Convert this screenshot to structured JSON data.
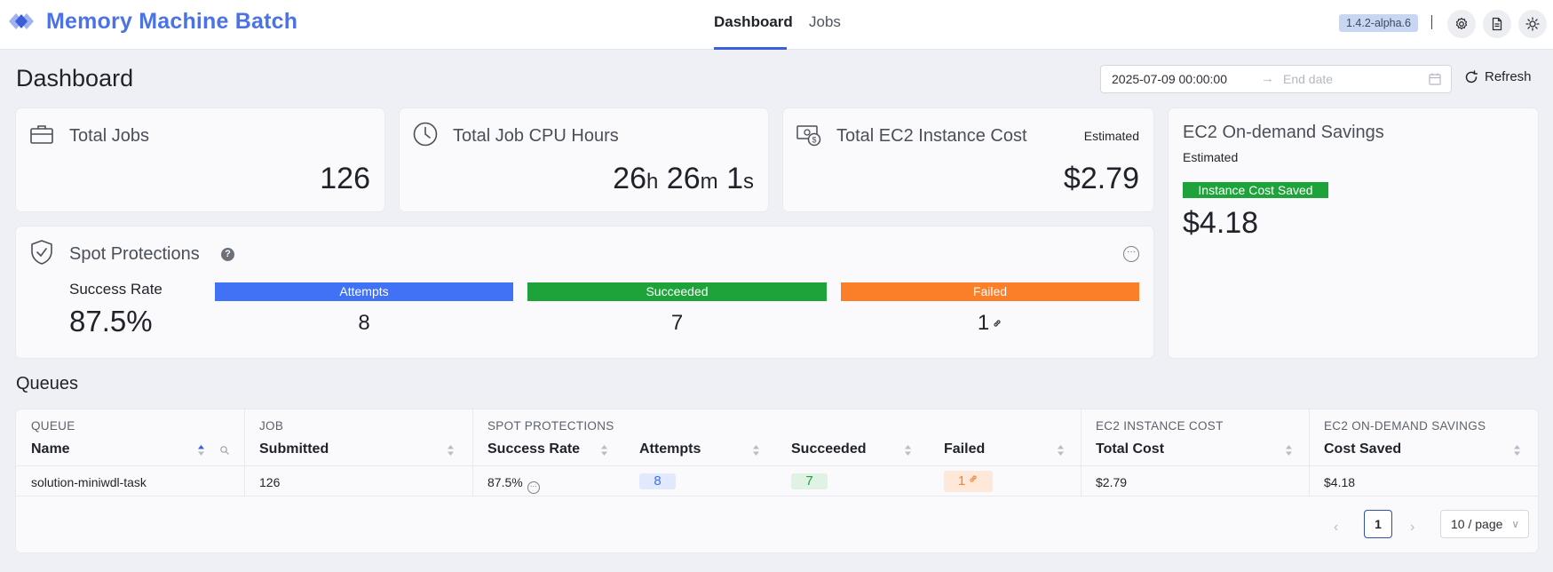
{
  "header": {
    "brand": "Memory Machine Batch",
    "nav": [
      {
        "label": "Dashboard",
        "active": true
      },
      {
        "label": "Jobs",
        "active": false
      }
    ],
    "version": "1.4.2-alpha.6",
    "icons": [
      "settings-icon",
      "document-icon",
      "theme-toggle-icon"
    ]
  },
  "page": {
    "title": "Dashboard",
    "date_start": "2025-07-09 00:00:00",
    "date_end_placeholder": "End date",
    "refresh_label": "Refresh"
  },
  "cards": {
    "total_jobs": {
      "title": "Total Jobs",
      "value": "126"
    },
    "cpu_hours": {
      "title": "Total Job CPU Hours",
      "hours": "26",
      "minutes": "26",
      "seconds": "1",
      "h": "h",
      "m": "m",
      "s": "s"
    },
    "ec2_cost": {
      "title": "Total EC2 Instance Cost",
      "tag": "Estimated",
      "value": "$2.79"
    },
    "savings": {
      "title": "EC2 On-demand Savings",
      "subtitle": "Estimated",
      "tag": "Instance Cost Saved",
      "value": "$4.18"
    },
    "spot": {
      "title": "Spot Protections",
      "help": "?",
      "more": "···",
      "rate_label": "Success Rate",
      "rate_value": "87.5%",
      "attempts_label": "Attempts",
      "attempts": "8",
      "succeeded_label": "Succeeded",
      "succeeded": "7",
      "failed_label": "Failed",
      "failed": "1"
    }
  },
  "queues": {
    "title": "Queues",
    "groups": {
      "queue": "QUEUE",
      "job": "JOB",
      "spot": "SPOT PROTECTIONS",
      "cost": "EC2 INSTANCE COST",
      "savings": "EC2 ON-DEMAND SAVINGS"
    },
    "columns": {
      "name": "Name",
      "submitted": "Submitted",
      "rate": "Success Rate",
      "attempts": "Attempts",
      "succeeded": "Succeeded",
      "failed": "Failed",
      "total_cost": "Total Cost",
      "cost_saved": "Cost Saved"
    },
    "rows": [
      {
        "name": "solution-miniwdl-task",
        "submitted": "126",
        "rate": "87.5%",
        "more": "···",
        "attempts": "8",
        "succeeded": "7",
        "failed": "1",
        "total_cost": "$2.79",
        "cost_saved": "$4.18"
      }
    ]
  },
  "pagination": {
    "prev": "‹",
    "page": "1",
    "next": "›",
    "page_size": "10 / page",
    "chevron": "∨"
  },
  "colors": {
    "accent": "#4b72e6",
    "attempts": "#4171f5",
    "succeeded": "#1ea33a",
    "failed": "#fb7e29"
  }
}
